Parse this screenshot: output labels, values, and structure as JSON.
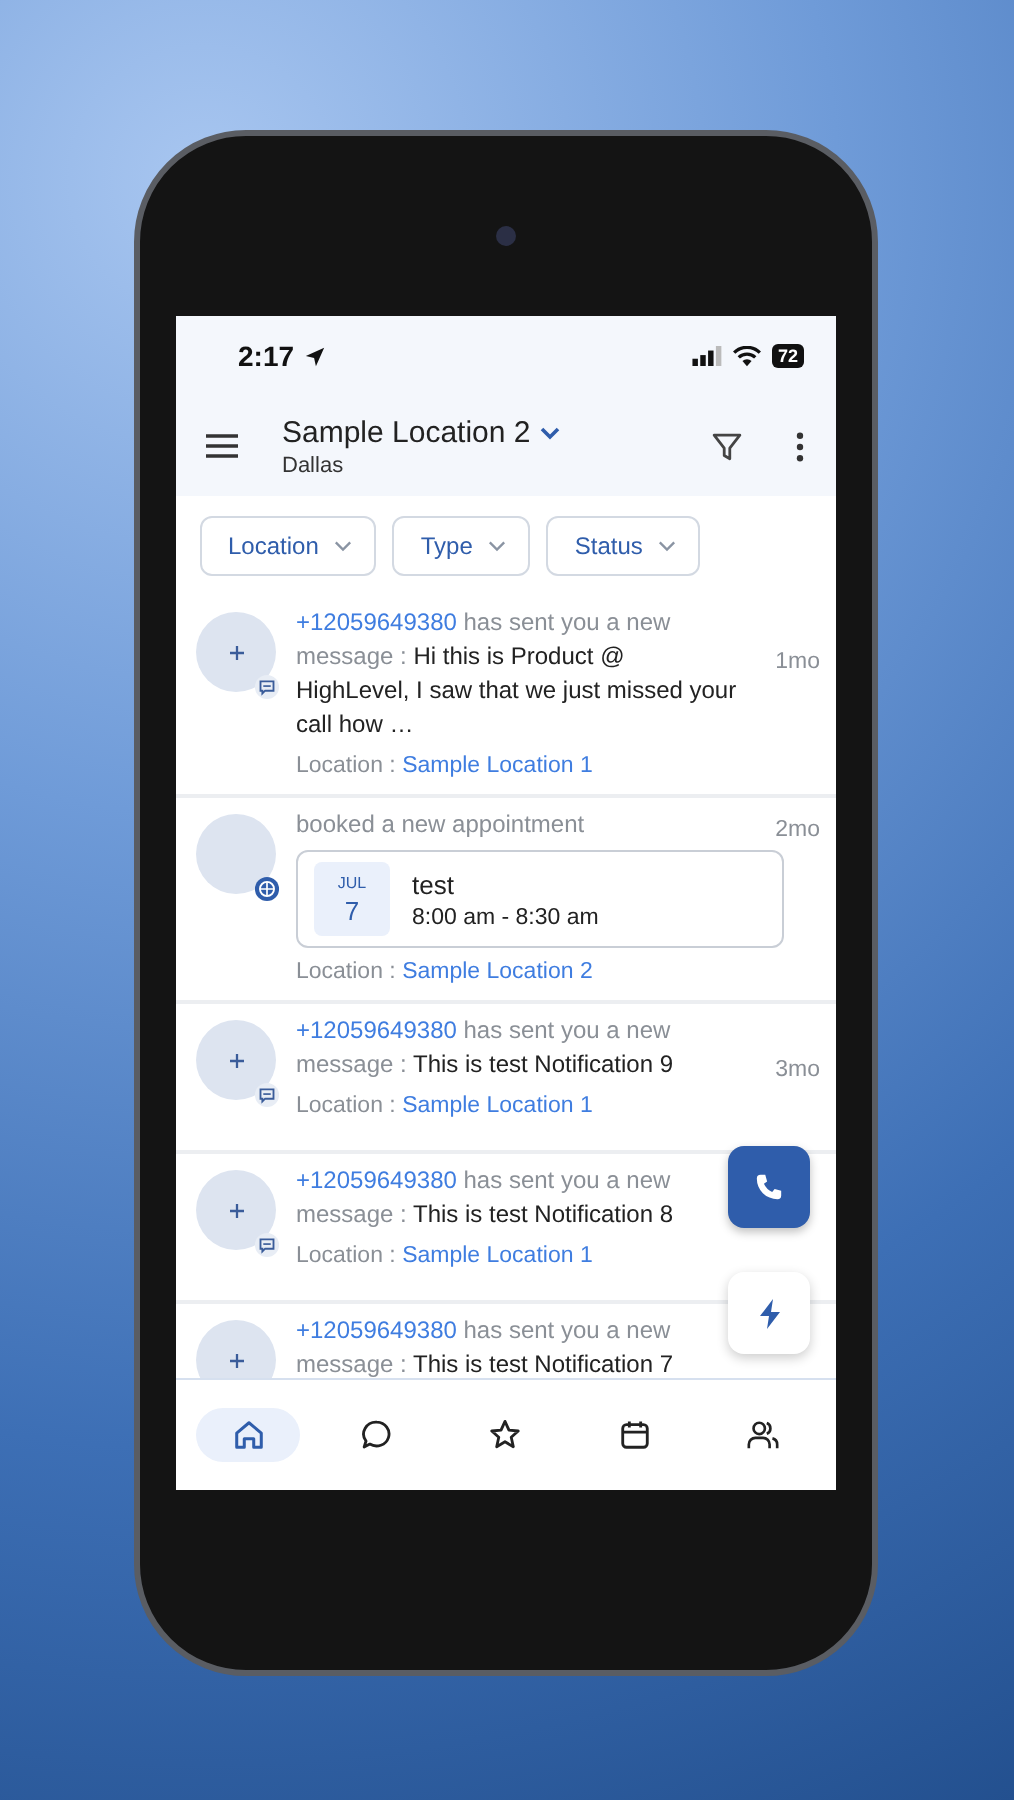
{
  "status_bar": {
    "time": "2:17",
    "battery": "72"
  },
  "header": {
    "title": "Sample Location 2",
    "subtitle": "Dallas"
  },
  "filters": [
    {
      "label": "Location"
    },
    {
      "label": "Type"
    },
    {
      "label": "Status"
    }
  ],
  "notifications": [
    {
      "kind": "message",
      "sender": "+12059649380",
      "text": "has sent you a new message :",
      "body": "Hi this is Product @ HighLevel, I saw that we just missed your call how …",
      "time": "1mo",
      "location_label": "Location :",
      "location": "Sample Location 1"
    },
    {
      "kind": "appointment",
      "text": "booked a new appointment",
      "time": "2mo",
      "appointment": {
        "month": "JUL",
        "day": "7",
        "title": "test",
        "hours": "8:00 am - 8:30 am"
      },
      "location_label": "Location :",
      "location": "Sample Location 2"
    },
    {
      "kind": "message",
      "sender": "+12059649380",
      "text": "has sent you a new message :",
      "body": "This is test Notification 9",
      "time": "3mo",
      "location_label": "Location :",
      "location": "Sample Location 1"
    },
    {
      "kind": "message",
      "sender": "+12059649380",
      "text": "has sent you a new message :",
      "body": "This is test Notification 8",
      "location_label": "Location :",
      "location": "Sample Location 1"
    },
    {
      "kind": "message",
      "sender": "+12059649380",
      "text": "has sent you a new message :",
      "body": "This is test Notification 7"
    }
  ],
  "nav": [
    {
      "selected": true
    },
    {
      "selected": false
    },
    {
      "selected": false
    },
    {
      "selected": false
    },
    {
      "selected": false
    }
  ]
}
